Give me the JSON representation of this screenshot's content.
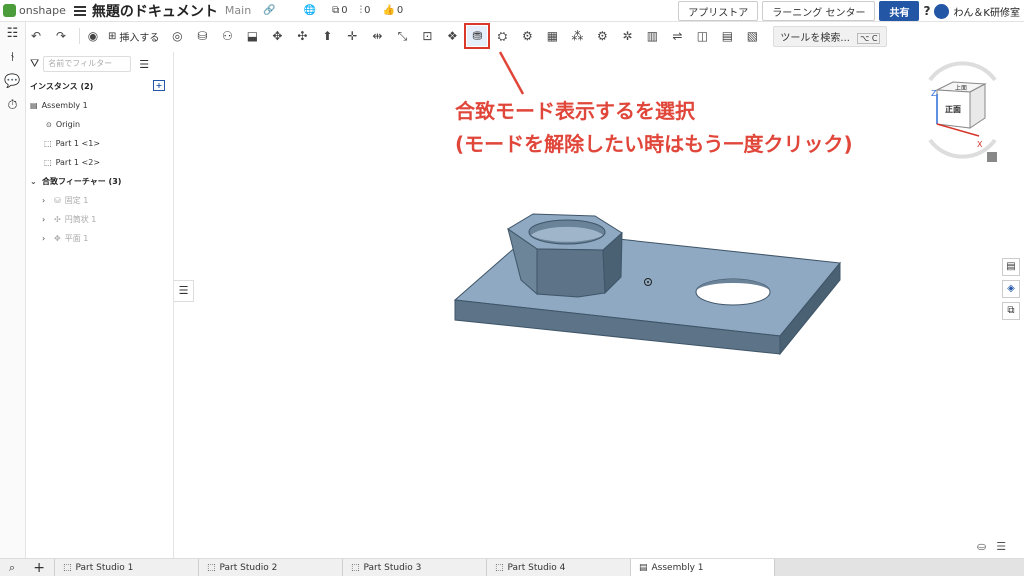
{
  "header": {
    "logo_text": "onshape",
    "doc_title": "無題のドキュメント",
    "branch": "Main",
    "link_icon": "link-icon",
    "globe_icon": "globe-icon",
    "copies_count": "0",
    "versions_count": "0",
    "likes_count": "0",
    "app_store": "アプリストア",
    "learning_center": "ラーニング センター",
    "share": "共有",
    "help_icon": "?",
    "user_name": "わん＆K研修室"
  },
  "toolbar": {
    "insert_label": "挿入する",
    "search_tools": "ツールを検索...",
    "search_shortcut": "⌥ C"
  },
  "panel": {
    "filter_placeholder": "名前でフィルター",
    "instances_header": "インスタンス (2)",
    "instances": [
      {
        "label": "Assembly 1"
      },
      {
        "label": "Origin"
      },
      {
        "label": "Part 1 <1>"
      },
      {
        "label": "Part 1 <2>"
      }
    ],
    "mates_header": "合致フィーチャー (3)",
    "mates": [
      {
        "label": "固定 1"
      },
      {
        "label": "円筒状 1"
      },
      {
        "label": "平面 1"
      }
    ]
  },
  "annotation": {
    "line1": "合致モード表示するを選択",
    "line2": "(モードを解除したい時はもう一度クリック)",
    "color": "#e0463a"
  },
  "viewcube": {
    "top_label": "上面",
    "front_label": "正面",
    "axis_z": "Z",
    "axis_x": "X"
  },
  "tabs": [
    {
      "label": "Part Studio 1"
    },
    {
      "label": "Part Studio 2"
    },
    {
      "label": "Part Studio 3"
    },
    {
      "label": "Part Studio 4"
    },
    {
      "label": "Assembly 1",
      "active": true
    }
  ],
  "colors": {
    "brand": "#4b9c3b",
    "accent": "#2456a6",
    "part_fill": "#8fa9c2"
  }
}
